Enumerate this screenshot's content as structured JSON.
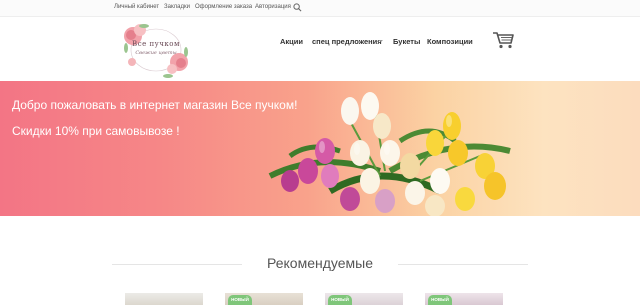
{
  "topbar": {
    "links": [
      "Личный кабинет",
      "Закладки",
      "Оформление заказа",
      "Авторизация"
    ]
  },
  "logo": {
    "line1": "Все пучком",
    "line2": "Cвежие цветы"
  },
  "nav": {
    "items": [
      "Акции",
      "спец предложения",
      "Букеты",
      "Композиции"
    ]
  },
  "banner": {
    "line1": "Добро пожаловать в интернет магазин Все пучком!",
    "line2": "Скидки 10% при самовывозе !"
  },
  "section": {
    "title": "Рекомендуемые"
  },
  "cards": [
    {
      "badge": ""
    },
    {
      "badge": "НОВЫЙ"
    },
    {
      "badge": "НОВЫЙ"
    },
    {
      "badge": "НОВЫЙ"
    }
  ],
  "colors": {
    "banner_start": "#f37585",
    "banner_end": "#fcdcbe",
    "badge": "#7fc67a"
  },
  "icons": {
    "search": "search-icon",
    "cart": "cart-icon"
  }
}
